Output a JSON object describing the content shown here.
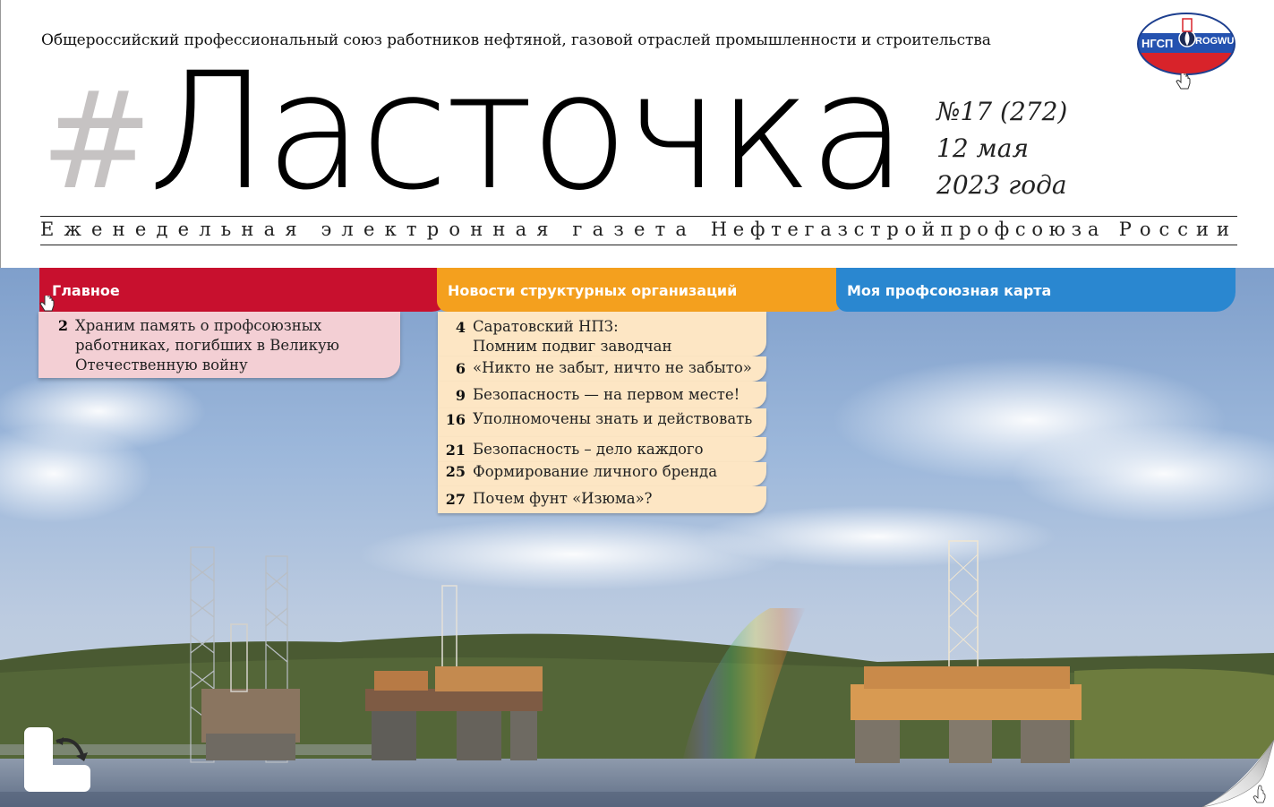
{
  "header": {
    "union_name": "Общероссийский профессиональный союз работников нефтяной, газовой отраслей промышленности и строительства",
    "hash": "#",
    "title": "Ласточка",
    "issue_number": "№17 (272)",
    "date_line1": "12 мая",
    "date_line2": "2023 года",
    "tagline_words": [
      "Еженедельная",
      "электронная",
      "газета",
      "Нефтегазстройпрофсоюза",
      "России"
    ],
    "logo_text_left": "НГСП",
    "logo_text_right": "ROGWU"
  },
  "tabs": [
    {
      "label": "Главное",
      "color": "#c8102e"
    },
    {
      "label": "Новости структурных организаций",
      "color": "#f4a01e"
    },
    {
      "label": "Моя профсоюзная карта",
      "color": "#2a87d0"
    }
  ],
  "main_menu": [
    {
      "page": "2",
      "lines": [
        "Храним память о профсоюзных",
        "работниках, погибших в Великую",
        "Отечественную войну"
      ]
    }
  ],
  "news_menu": [
    {
      "page": "4",
      "lines": [
        "Саратовский НПЗ:",
        "Помним подвиг заводчан"
      ]
    },
    {
      "page": "6",
      "lines": [
        "«Никто не забыт, ничто не забыто»"
      ]
    },
    {
      "page": "9",
      "lines": [
        "Безопасность — на первом месте!"
      ]
    },
    {
      "page": "16",
      "lines": [
        "Уполномочены знать и действовать"
      ]
    },
    {
      "page": "21",
      "lines": [
        "Безопасность – дело каждого"
      ]
    },
    {
      "page": "25",
      "lines": [
        "Формирование личного бренда"
      ]
    },
    {
      "page": "27",
      "lines": [
        "Почем фунт «Изюма»?"
      ]
    }
  ],
  "colors": {
    "pink_panel": "#f3cfd4",
    "cream_panel": "#fde6c4",
    "hash_grey": "#c6c3c3"
  },
  "icons": {
    "rotate": "rotate-page-icon",
    "curl": "page-curl-icon",
    "cursor": "hand-pointer-icon"
  }
}
